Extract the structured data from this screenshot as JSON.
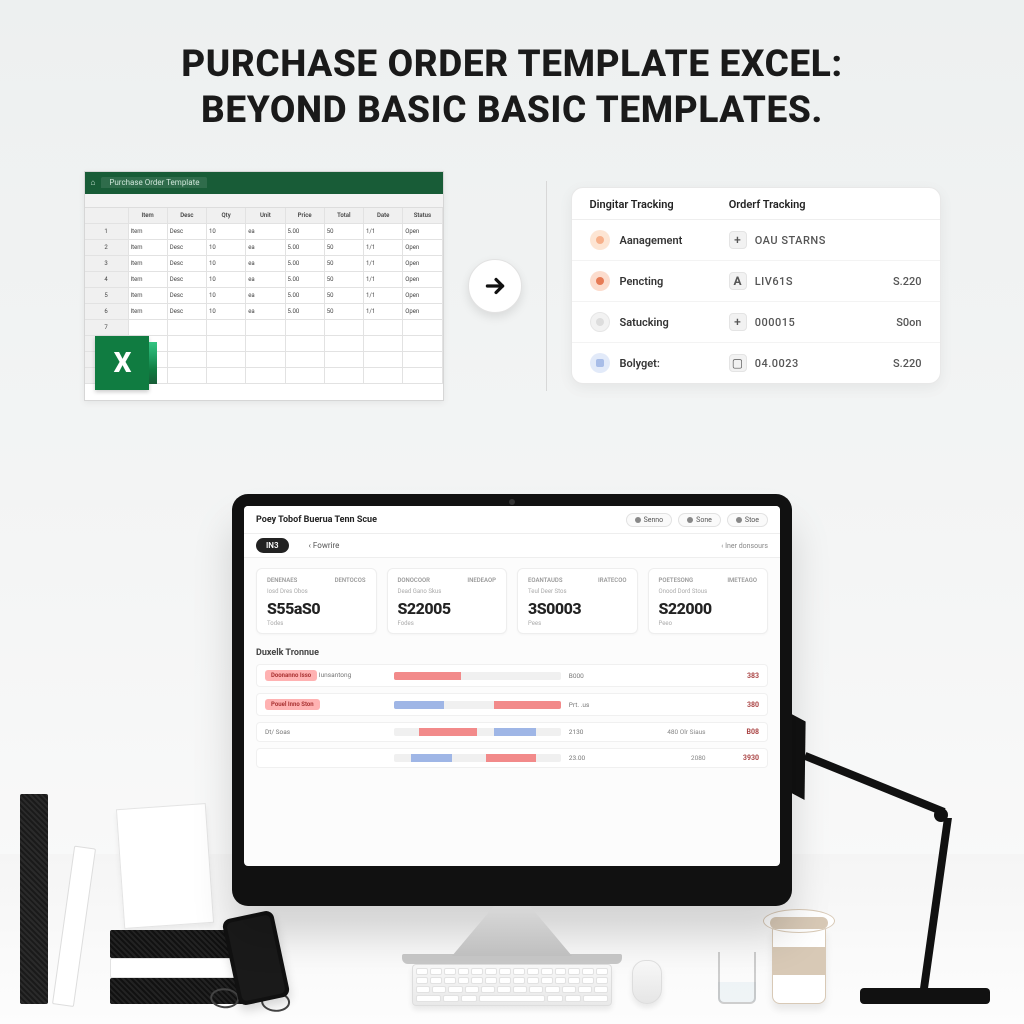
{
  "headline": {
    "line1": "Purchase Order Template Excel:",
    "line2": "Beyond Basic Basic Templates."
  },
  "excel": {
    "title_tab": "Purchase Order Template",
    "logo_text": "X",
    "col_headers": [
      "Item",
      "Desc",
      "Qty",
      "Unit",
      "Price",
      "Total",
      "Date",
      "Status"
    ],
    "row_sample": "—"
  },
  "tracking": {
    "head": {
      "col1": "Dingitar Tracking",
      "col2": "Orderf Tracking",
      "col3": ""
    },
    "rows": [
      {
        "label": "Aanagement",
        "icon_color": "#f7b08a",
        "mid_glyph": "+",
        "mid_text": "OAU STARNS",
        "val": ""
      },
      {
        "label": "Pencting",
        "icon_color": "#e67a55",
        "mid_glyph": "A",
        "mid_text": "LIV61S",
        "val": "S.220"
      },
      {
        "label": "Satucking",
        "icon_color": "#e9e9e9",
        "mid_glyph": "+",
        "mid_text": "000015",
        "val": "S0on"
      },
      {
        "label": "Bolyget:",
        "icon_color": "#a8bde8",
        "mid_glyph": "▢",
        "mid_text": "04.0023",
        "val": "S.220"
      }
    ]
  },
  "dashboard": {
    "title": "Poey Tobof Buerua Tenn Scue",
    "actions": [
      {
        "label": "Senno"
      },
      {
        "label": "Sone"
      },
      {
        "label": "Stoe"
      }
    ],
    "tabs": {
      "active": "IN3",
      "second": "Fowrire",
      "crumb": "Iner donsours"
    },
    "stats": [
      {
        "hl": "Denenaes",
        "hr": "Dentocos",
        "sub": "Iosd Dres Obos",
        "val": "S55aS0",
        "foot": "Todes"
      },
      {
        "hl": "Donocoor",
        "hr": "Inedeaop",
        "sub": "Dead Gano Skus",
        "val": "S22005",
        "foot": "Fodes"
      },
      {
        "hl": "Eoantauds",
        "hr": "Iratecoo",
        "sub": "Teul Deer Stos",
        "val": "3S0003",
        "foot": "Pees"
      },
      {
        "hl": "Poetesong",
        "hr": "Imeteago",
        "sub": "Onood Dord Stous",
        "val": "S22000",
        "foot": "Peeo"
      }
    ],
    "section_title": "Duxelk Tronnue",
    "rows": [
      {
        "badge": "Doonanno Isso",
        "name": "Iunsantong",
        "segs": [
          [
            0,
            40,
            "red"
          ]
        ],
        "mid": "B000",
        "pct": "",
        "amt": "383"
      },
      {
        "badge": "Pouel Inno Ston",
        "name": "",
        "segs": [
          [
            0,
            30,
            "blue"
          ],
          [
            60,
            40,
            "red"
          ]
        ],
        "mid": "Prt. .us",
        "pct": "",
        "amt": "380"
      },
      {
        "badge": "",
        "name": "Dt/ Soas",
        "segs": [
          [
            15,
            35,
            "red"
          ],
          [
            60,
            25,
            "blue"
          ]
        ],
        "mid": "2130",
        "pct": "480 Olr Siaus",
        "amt": "B08"
      },
      {
        "badge": "",
        "name": "",
        "segs": [
          [
            10,
            25,
            "blue"
          ],
          [
            55,
            30,
            "red"
          ]
        ],
        "mid": "23.00",
        "pct": "2080",
        "amt": "3930"
      }
    ]
  }
}
